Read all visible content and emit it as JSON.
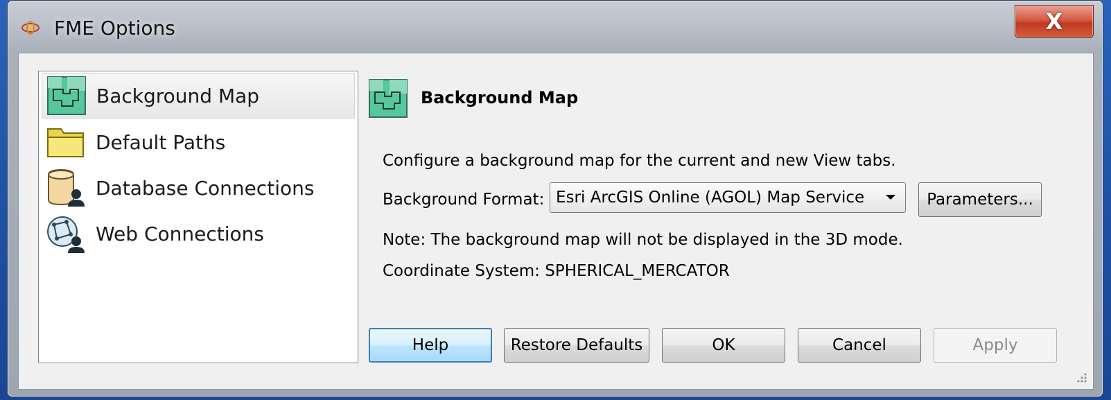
{
  "window": {
    "title": "FME Options",
    "close_glyph": "X",
    "title_icon": "fme-logo-icon"
  },
  "nav": {
    "items": [
      {
        "label": "Background Map",
        "icon": "background-map-icon",
        "selected": true
      },
      {
        "label": "Default Paths",
        "icon": "folder-icon",
        "selected": false
      },
      {
        "label": "Database Connections",
        "icon": "database-user-icon",
        "selected": false
      },
      {
        "label": "Web Connections",
        "icon": "globe-user-icon",
        "selected": false
      }
    ]
  },
  "panel": {
    "title": "Background Map",
    "description": "Configure a background map for the current and new View tabs.",
    "format_label": "Background Format:",
    "format_value": "Esri ArcGIS Online (AGOL) Map Service",
    "parameters_label": "Parameters...",
    "note": "Note: The background map will not be displayed in the 3D mode.",
    "coordinate_system": "Coordinate System: SPHERICAL_MERCATOR"
  },
  "buttons": {
    "help": "Help",
    "restore": "Restore Defaults",
    "ok": "OK",
    "cancel": "Cancel",
    "apply": "Apply"
  },
  "colors": {
    "desktop": "#1d4fa3",
    "close_button": "#c8452c",
    "map_icon_green": "#4fc39a",
    "default_button_border": "#3c7fb1"
  }
}
